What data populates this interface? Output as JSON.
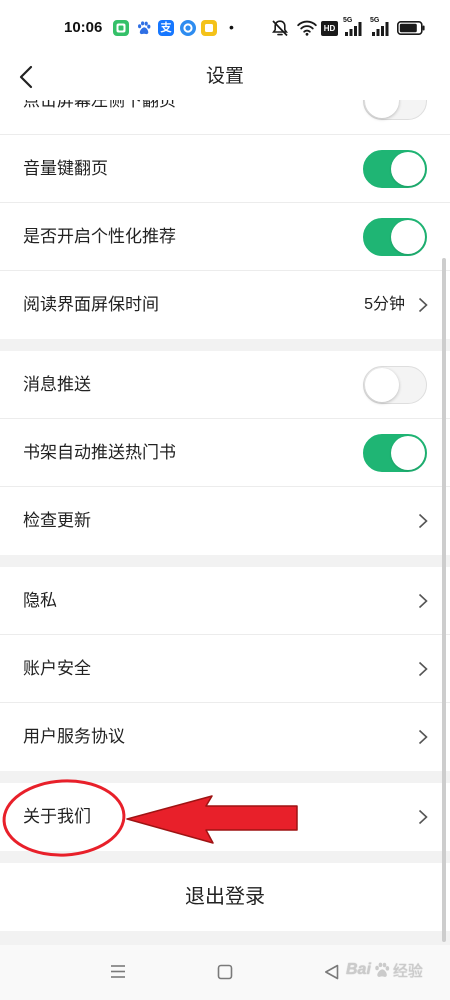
{
  "status_bar": {
    "time": "10:06",
    "notification_icons": [
      "messages-app-icon",
      "baidu-paw-icon",
      "alipay-icon",
      "browser-circle-icon",
      "notes-app-icon"
    ],
    "alipay_glyph": "支",
    "more_dot": "•",
    "system_icons": [
      "mute-icon",
      "wifi-icon",
      "hd-icon",
      "signal-icon",
      "signal-icon",
      "battery-icon"
    ],
    "hd_label": "HD",
    "sim": [
      {
        "label": "5G",
        "level": 4
      },
      {
        "label": "5G",
        "level": 4
      }
    ],
    "battery_level": 0.85
  },
  "header": {
    "title": "设置",
    "back_icon": "chevron-left-icon"
  },
  "sections": [
    {
      "rows": [
        {
          "label": "点击屏幕左侧下翻页",
          "on": false
        },
        {
          "label": "音量键翻页",
          "on": true
        },
        {
          "label": "是否开启个性化推荐",
          "on": true
        },
        {
          "label": "阅读界面屏保时间",
          "value": "5分钟"
        }
      ]
    },
    {
      "rows": [
        {
          "label": "消息推送",
          "on": false
        },
        {
          "label": "书架自动推送热门书",
          "on": true
        },
        {
          "label": "检查更新"
        }
      ]
    },
    {
      "rows": [
        {
          "label": "隐私"
        },
        {
          "label": "账户安全"
        },
        {
          "label": "用户服务协议"
        }
      ]
    },
    {
      "rows": [
        {
          "label": "关于我们"
        }
      ]
    }
  ],
  "logout": {
    "label": "退出登录"
  },
  "nav_bar": {
    "icons": [
      "menu-icon",
      "home-square-icon",
      "back-triangle-icon"
    ]
  },
  "watermark": {
    "brand": "Bai",
    "product": "经验"
  },
  "colors": {
    "accent": "#1fb574",
    "annotation": "#e8202a",
    "text": "#1f1f1f",
    "section_gap": "#f2f2f2"
  }
}
